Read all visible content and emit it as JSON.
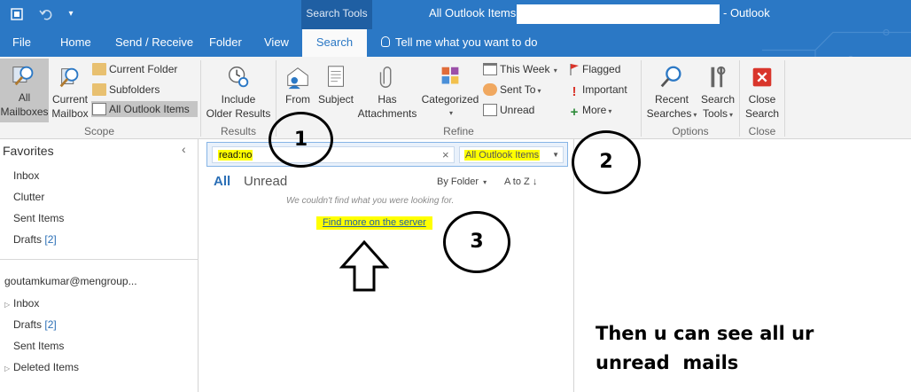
{
  "titlebar": {
    "context_tab": "Search Tools",
    "title_prefix": "All Outlook Items -",
    "title_suffix": "- Outlook"
  },
  "tabs": [
    {
      "label": "File"
    },
    {
      "label": "Home"
    },
    {
      "label": "Send / Receive"
    },
    {
      "label": "Folder"
    },
    {
      "label": "View"
    },
    {
      "label": "Search"
    }
  ],
  "tell_me": "Tell me what you want to do",
  "ribbon": {
    "scope": {
      "label": "Scope",
      "all_mailboxes": [
        "All",
        "Mailboxes"
      ],
      "current_mailbox": [
        "Current",
        "Mailbox"
      ],
      "current_folder": "Current Folder",
      "subfolders": "Subfolders",
      "all_outlook_items": "All Outlook Items"
    },
    "results": {
      "label": "Results",
      "include_older": [
        "Include",
        "Older Results"
      ]
    },
    "refine": {
      "label": "Refine",
      "from": "From",
      "subject": "Subject",
      "has_attachments": [
        "Has",
        "Attachments"
      ],
      "categorized": "Categorized",
      "this_week": "This Week",
      "sent_to": "Sent To",
      "unread": "Unread",
      "flagged": "Flagged",
      "important": "Important",
      "more": "More"
    },
    "options": {
      "label": "Options",
      "recent_searches": [
        "Recent",
        "Searches"
      ],
      "search_tools": [
        "Search",
        "Tools"
      ]
    },
    "close": {
      "label": "Close",
      "close_search": [
        "Close",
        "Search"
      ]
    }
  },
  "nav": {
    "favorites": "Favorites",
    "fav_items": [
      {
        "label": "Inbox"
      },
      {
        "label": "Clutter"
      },
      {
        "label": "Sent Items"
      },
      {
        "label": "Drafts",
        "count": "[2]"
      }
    ],
    "account": "goutamkumar@mengroup...",
    "account_items": [
      {
        "label": "Inbox"
      },
      {
        "label": "Drafts",
        "count": "[2]"
      },
      {
        "label": "Sent Items"
      },
      {
        "label": "Deleted Items"
      }
    ]
  },
  "search": {
    "query": "read:no",
    "clear": "×",
    "scope": "All Outlook Items"
  },
  "list": {
    "filter_all": "All",
    "filter_unread": "Unread",
    "sort_by": "By Folder",
    "sort_order": "A to Z",
    "empty_message": "We couldn't find what you were looking for.",
    "find_more": "Find more on the server"
  },
  "annotations": {
    "step1": "1",
    "step2": "2",
    "step3": "3",
    "note_line1": "Then u can see all ur",
    "note_line2": "unread  mails"
  },
  "colors": {
    "accent": "#2b78c5",
    "highlight": "#ffff00",
    "link": "#1f5fa3"
  }
}
